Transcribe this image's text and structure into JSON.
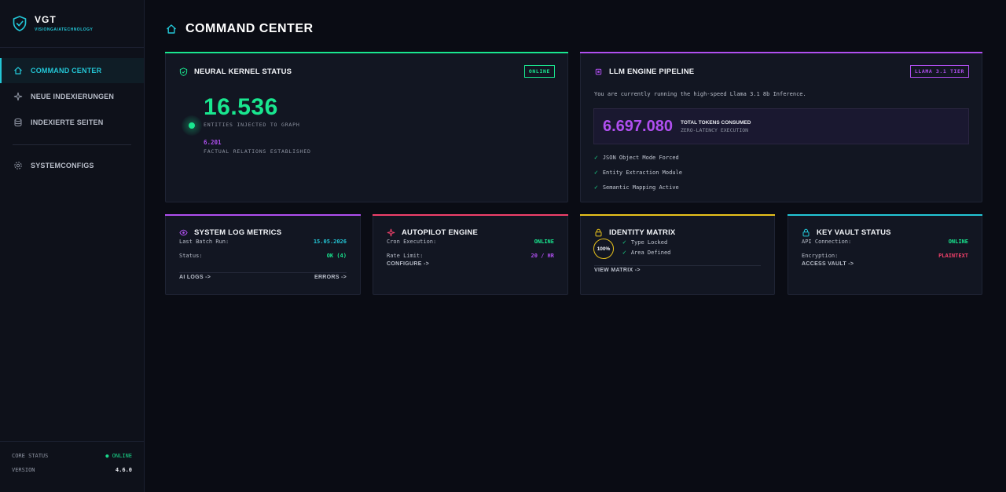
{
  "brand": {
    "name": "VGT",
    "subtitle": "VISIONGAIATECHNOLOGY"
  },
  "sidebar": {
    "items": [
      {
        "label": "COMMAND CENTER",
        "icon": "home-icon"
      },
      {
        "label": "NEUE INDEXIERUNGEN",
        "icon": "sparkle-icon"
      },
      {
        "label": "INDEXIERTE SEITEN",
        "icon": "database-icon"
      },
      {
        "label": "SYSTEMCONFIGS",
        "icon": "gear-icon"
      }
    ],
    "footer": {
      "core_status_label": "CORE STATUS",
      "core_status_value": "● ONLINE",
      "version_label": "VERSION",
      "version_value": "4.6.0"
    }
  },
  "page": {
    "title": "COMMAND CENTER"
  },
  "neural": {
    "title": "NEURAL KERNEL STATUS",
    "badge": "ONLINE",
    "entities_value": "16.536",
    "entities_label": "ENTITIES INJECTED TO GRAPH",
    "relations_value": "6.201",
    "relations_label": "FACTUAL RELATIONS ESTABLISHED"
  },
  "llm": {
    "title": "LLM ENGINE PIPELINE",
    "badge": "LLAMA 3.1 TIER",
    "description": "You are currently running the high-speed Llama 3.1 8b Inference.",
    "tokens_value": "6.697.080",
    "tokens_label": "TOTAL TOKENS CONSUMED",
    "tokens_sub": "ZERO-LATENCY EXECUTION",
    "features": [
      "JSON Object Mode Forced",
      "Entity Extraction Module",
      "Semantic Mapping Active"
    ]
  },
  "syslog": {
    "title": "SYSTEM LOG METRICS",
    "last_run_label": "Last Batch Run:",
    "last_run_value": "15.05.2026",
    "status_label": "Status:",
    "status_value": "OK (4)",
    "link_ai": "AI LOGS ->",
    "link_errors": "ERRORS ->"
  },
  "autopilot": {
    "title": "AUTOPILOT ENGINE",
    "cron_label": "Cron Execution:",
    "cron_value": "ONLINE",
    "rate_label": "Rate Limit:",
    "rate_value": "20 / HR",
    "link": "CONFIGURE ->"
  },
  "identity": {
    "title": "IDENTITY MATRIX",
    "ring_value": "100%",
    "checks": [
      "Type Locked",
      "Area Defined"
    ],
    "link": "VIEW MATRIX ->"
  },
  "vault": {
    "title": "KEY VAULT STATUS",
    "api_label": "API Connection:",
    "api_value": "ONLINE",
    "enc_label": "Encryption:",
    "enc_value": "PLAINTEXT",
    "link": "ACCESS VAULT ->"
  },
  "colors": {
    "accent_cyan": "#23c6d6",
    "green": "#19e68f",
    "purple": "#b04ff0",
    "red": "#f0406a",
    "yellow": "#e8c21c"
  }
}
